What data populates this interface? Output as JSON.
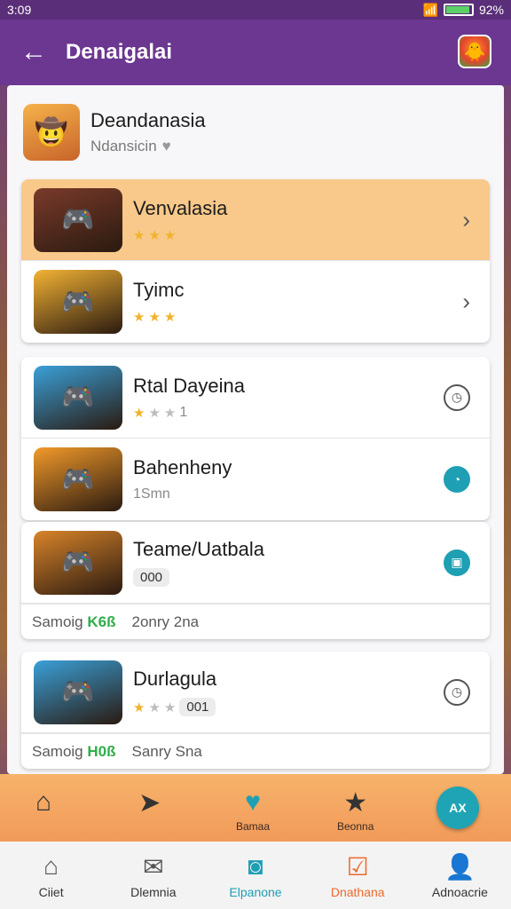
{
  "status_bar": {
    "time": "3:09",
    "battery": "92%",
    "battery_level": 0.92
  },
  "app_bar": {
    "title": "Denaigalai",
    "back_icon": "arrow-left-icon",
    "avatar_icon": "game-avatar-icon"
  },
  "header": {
    "title": "Deandanasia",
    "subtitle": "Ndansicin",
    "heart_icon": "heart-icon"
  },
  "groups": [
    {
      "rows": [
        {
          "title": "Venvalasia",
          "rating": 3,
          "meta_text": "",
          "action_icon": "chevron-right-icon",
          "thumb_color": "#7a3a2a",
          "highlight": true
        },
        {
          "title": "Tyimc",
          "rating": 3,
          "meta_text": "",
          "action_icon": "chevron-right-icon",
          "thumb_color": "#f2b234",
          "highlight": false
        }
      ]
    },
    {
      "rows": [
        {
          "title": "Rtal Dayeina",
          "rating": 1,
          "meta_text": "1",
          "action_icon": "clock-icon",
          "thumb_color": "#3aa0d8",
          "highlight": false
        },
        {
          "title": "Bahenheny",
          "rating": 0,
          "meta_text": "1Smn",
          "action_icon": "timer-icon",
          "thumb_color": "#f29a2a",
          "highlight": false
        }
      ]
    },
    {
      "rows": [
        {
          "title": "Teame/Uatbala",
          "rating": 0,
          "meta_text": "000",
          "action_icon": "bookmark-icon",
          "thumb_color": "#d8842a",
          "highlight": false
        }
      ],
      "footer": {
        "left": "Samoig",
        "green": "K6ß",
        "right": "2onry 2na"
      }
    },
    {
      "rows": [
        {
          "title": "Durlagula",
          "rating": 1,
          "meta_text": "001",
          "action_icon": "clock-icon",
          "thumb_color": "#3aa0d8",
          "highlight": false
        }
      ],
      "footer": {
        "left": "Samoig",
        "green": "H0ß",
        "right": "Sanry Sna"
      }
    }
  ],
  "actions": [
    {
      "label": "",
      "icon": "home-icon"
    },
    {
      "label": "",
      "icon": "send-icon"
    },
    {
      "label": "Bamaa",
      "icon": "heart-badge-icon"
    },
    {
      "label": "Beonna",
      "icon": "star-badge-icon"
    }
  ],
  "fab": {
    "label": "AX"
  },
  "nav": [
    {
      "label": "Ciiet",
      "icon": "home-outline-icon"
    },
    {
      "label": "Dlemnia",
      "icon": "mail-icon"
    },
    {
      "label": "Elpanone",
      "icon": "circle-square-icon"
    },
    {
      "label": "Dnathana",
      "icon": "check-badge-icon"
    },
    {
      "label": "Adnoacrie",
      "icon": "person-icon"
    }
  ],
  "colors": {
    "app_bar": "#6b3791",
    "accent_teal": "#1e9fb3",
    "accent_orange": "#ee6a2c",
    "highlight_row": "#f8c98a"
  }
}
